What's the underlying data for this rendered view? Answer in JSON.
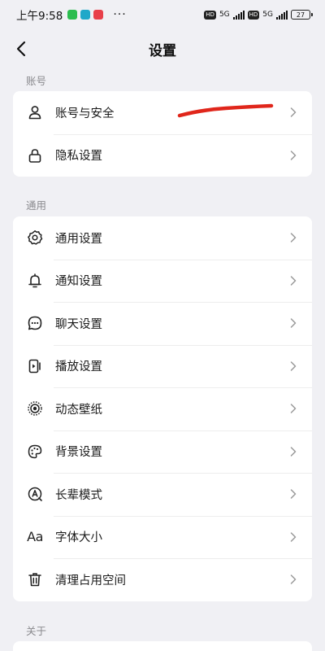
{
  "status_bar": {
    "time": "上午9:58",
    "more": "···",
    "hd1": "HD",
    "net1": "5G",
    "hd2": "HD",
    "net2": "5G",
    "battery": "27"
  },
  "nav": {
    "title": "设置"
  },
  "sections": {
    "account": {
      "label": "账号",
      "items": [
        {
          "label": "账号与安全",
          "icon": "person-icon"
        },
        {
          "label": "隐私设置",
          "icon": "lock-icon"
        }
      ]
    },
    "general": {
      "label": "通用",
      "items": [
        {
          "label": "通用设置",
          "icon": "gear-icon"
        },
        {
          "label": "通知设置",
          "icon": "bell-icon"
        },
        {
          "label": "聊天设置",
          "icon": "chat-bubble-icon"
        },
        {
          "label": "播放设置",
          "icon": "play-device-icon"
        },
        {
          "label": "动态壁纸",
          "icon": "live-wallpaper-icon"
        },
        {
          "label": "背景设置",
          "icon": "palette-icon"
        },
        {
          "label": "长辈模式",
          "icon": "elder-mode-icon"
        },
        {
          "label": "字体大小",
          "icon": "font-size-icon",
          "glyph": "Aa"
        },
        {
          "label": "清理占用空间",
          "icon": "trash-icon"
        }
      ]
    },
    "about": {
      "label": "关于"
    }
  },
  "colors": {
    "background": "#f0f0f4",
    "card": "#ffffff",
    "section_label": "#8a8a8e",
    "redaction": "#e0261b"
  }
}
